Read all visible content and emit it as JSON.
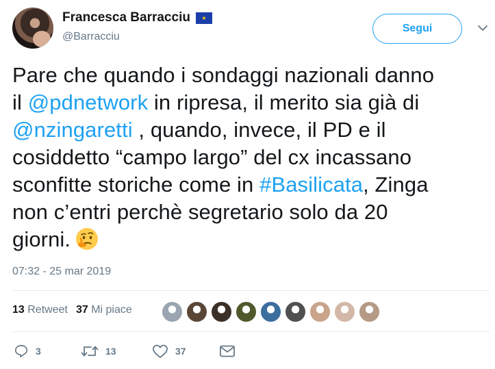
{
  "author": {
    "display_name": "Francesca Barracciu",
    "username": "@Barracciu",
    "badge_icon": "eu-flag-icon"
  },
  "follow_label": "Segui",
  "tweet": {
    "lines": [
      [
        {
          "t": "Pare che quando i sondaggi nazionali danno",
          "link": false
        }
      ],
      [
        {
          "t": "il ",
          "link": false
        },
        {
          "t": "@pdnetwork",
          "link": true
        },
        {
          "t": " in ripresa, il merito sia già di",
          "link": false
        }
      ],
      [
        {
          "t": "@nzingaretti",
          "link": true
        },
        {
          "t": " , quando, invece, il PD e il",
          "link": false
        }
      ],
      [
        {
          "t": "cosiddetto “campo largo” del cx incassano",
          "link": false
        }
      ],
      [
        {
          "t": "sconfitte storiche come in ",
          "link": false
        },
        {
          "t": "#Basilicata",
          "link": true
        },
        {
          "t": ", Zinga",
          "link": false
        }
      ],
      [
        {
          "t": "non c’entri perchè  segretario solo da 20",
          "link": false
        }
      ],
      [
        {
          "t": "giorni.",
          "link": false
        }
      ]
    ],
    "emoji": "thinking-face-icon"
  },
  "timestamp": "07:32 - 25 mar 2019",
  "stats": {
    "retweet_count": "13",
    "retweet_label": "Retweet",
    "like_count": "37",
    "like_label": "Mi piace"
  },
  "liker_avatars": [
    "#9aa5b1",
    "#5b4636",
    "#3b3028",
    "#4f5a2c",
    "#3c6e9e",
    "#505050",
    "#c9a38a",
    "#d2b8a8",
    "#b59a85"
  ],
  "actions": {
    "reply_count": "3",
    "retweet_count": "13",
    "like_count": "37"
  },
  "colors": {
    "link": "#1da1f2",
    "muted": "#657786",
    "text": "#14171a"
  }
}
